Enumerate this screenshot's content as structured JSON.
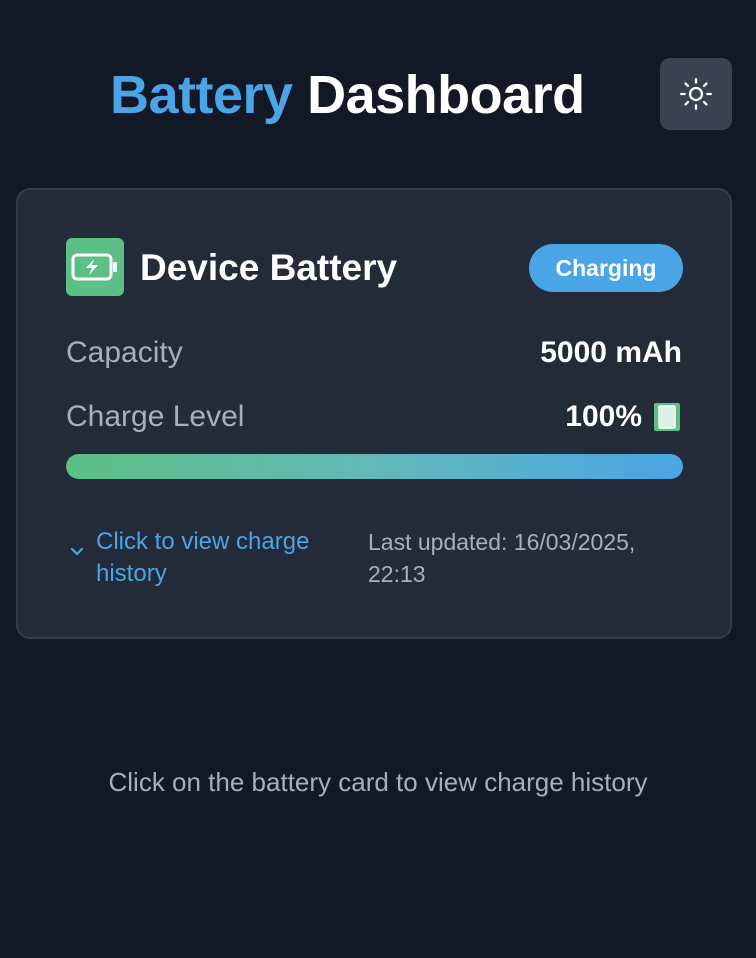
{
  "header": {
    "title_accent": "Battery",
    "title_main": "Dashboard",
    "theme_icon": "sun-icon"
  },
  "card": {
    "icon": "battery-charging-icon",
    "title": "Device Battery",
    "status": "Charging",
    "capacity_label": "Capacity",
    "capacity_value": "5000 mAh",
    "charge_label": "Charge Level",
    "charge_value": "100%",
    "charge_fraction": 1.0,
    "history_link": "Click to view charge history",
    "last_updated": "Last updated: 16/03/2025, 22:13"
  },
  "hint": "Click on the battery card to view charge history",
  "colors": {
    "background": "#131826",
    "card": "#232a38",
    "accent_blue": "#4aa5e6",
    "accent_green": "#5cbf85",
    "muted_text": "#a7afbc"
  }
}
